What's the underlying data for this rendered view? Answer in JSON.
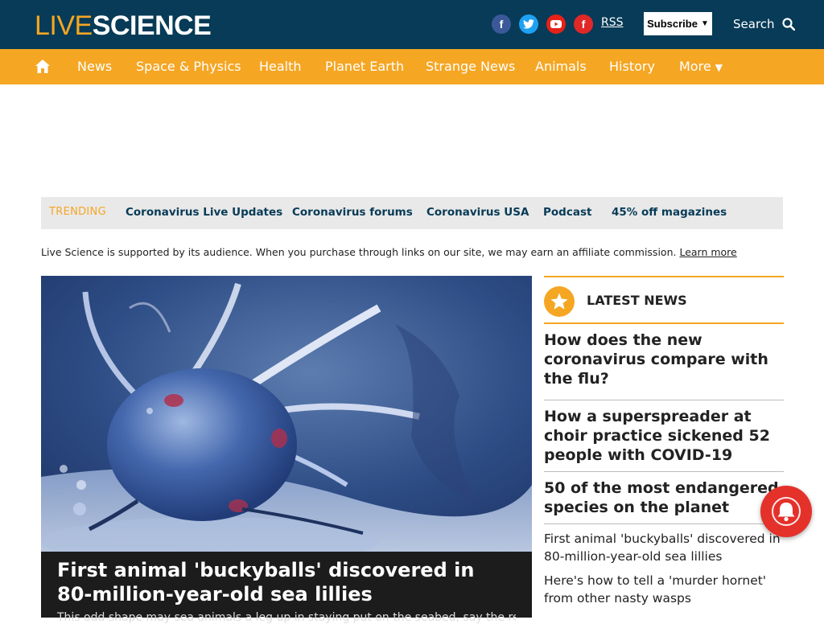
{
  "header": {
    "logo_left": "LIVE",
    "logo_right": "SCIENCE",
    "social_facebook": "f",
    "social_flipboard": "f",
    "rss": "RSS",
    "subscribe": "Subscribe",
    "search": "Search"
  },
  "nav": {
    "items": [
      "News",
      "Space & Physics",
      "Health",
      "Planet Earth",
      "Strange News",
      "Animals",
      "History",
      "More"
    ]
  },
  "trending": {
    "label": "TRENDING",
    "links": [
      "Coronavirus Live Updates",
      "Coronavirus forums",
      "Coronavirus USA",
      "Podcast",
      "45% off magazines"
    ]
  },
  "affiliate": {
    "text": "Live Science is supported by its audience. When you purchase through links on our site, we may earn an affiliate commission.",
    "learn_more": "Learn more"
  },
  "hero": {
    "title": "First animal 'buckyballs' discovered in 80-million-year-old sea lillies",
    "subtitle": "This odd shape may sea animals a leg up in staying put on the seabed, say the researchers"
  },
  "sidebar": {
    "heading": "LATEST NEWS",
    "featured": [
      "How does the new coronavirus compare with the flu?",
      "How a superspreader at choir practice sickened 52 people with COVID-19",
      "50 of the most endangered species on the planet"
    ],
    "list": [
      "First animal 'buckyballs' discovered in 80-million-year-old sea lillies",
      "Here's how to tell a 'murder hornet' from other nasty wasps"
    ]
  },
  "colors": {
    "header_bg": "#073b57",
    "accent": "#f5a623",
    "notification": "#e4312a"
  }
}
